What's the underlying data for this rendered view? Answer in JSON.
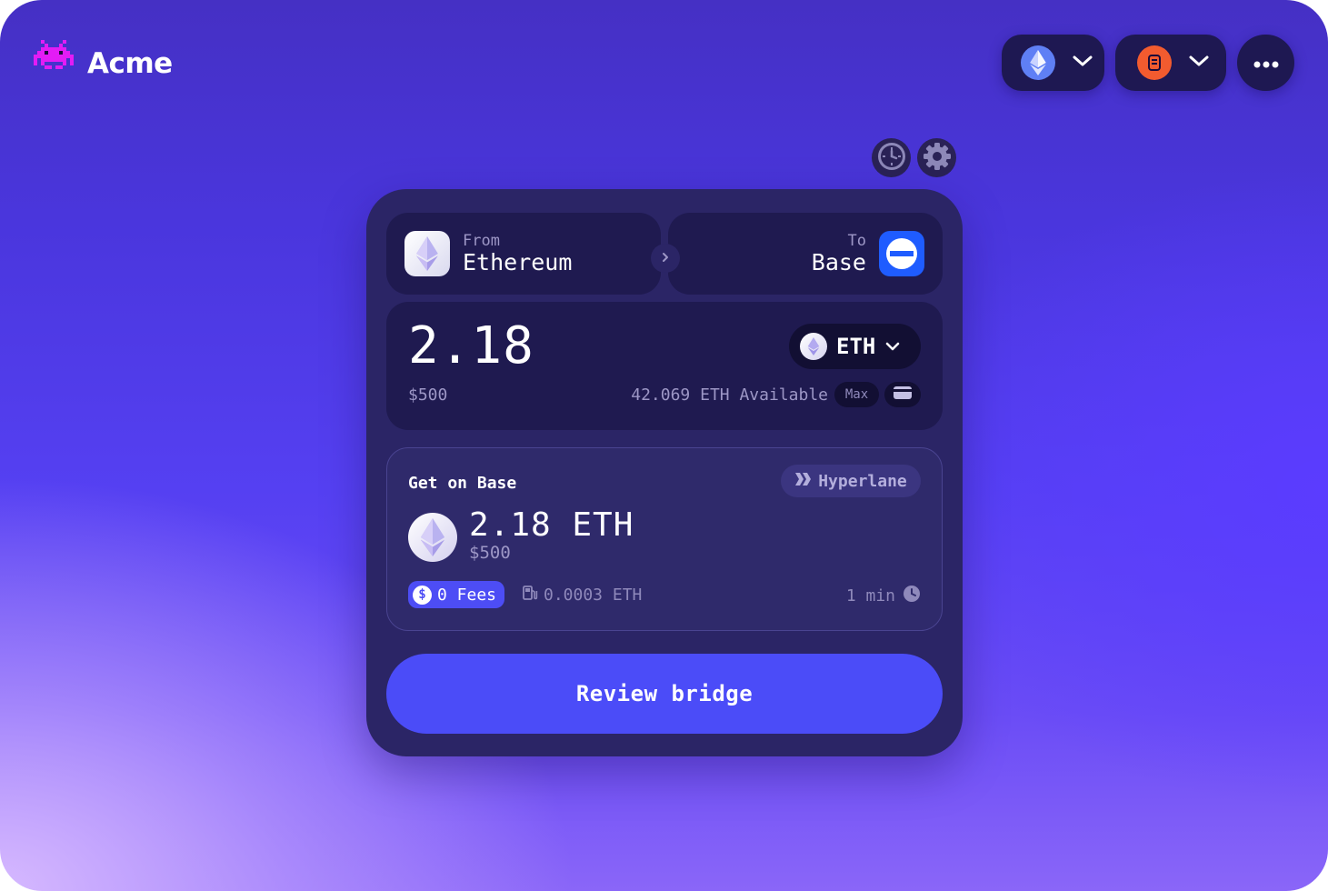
{
  "brand": {
    "name": "Acme"
  },
  "header": {
    "network_icon": "ethereum-icon",
    "account_icon": "account-avatar-icon",
    "more_icon": "more-dots-icon"
  },
  "tools": {
    "history_icon": "clock-icon",
    "settings_icon": "gear-icon"
  },
  "bridge": {
    "from": {
      "label": "From",
      "chain": "Ethereum"
    },
    "to": {
      "label": "To",
      "chain": "Base"
    },
    "amount": "2.18",
    "amount_usd": "$500",
    "token": "ETH",
    "available": "42.069 ETH Available",
    "max_label": "Max"
  },
  "receive": {
    "title": "Get on Base",
    "provider": "Hyperlane",
    "amount": "2.18 ETH",
    "amount_usd": "$500",
    "fees": "0 Fees",
    "gas": "0.0003 ETH",
    "eta": "1 min"
  },
  "actions": {
    "review_label": "Review bridge"
  },
  "colors": {
    "accent": "#4b4cf8",
    "card": "#2b2566",
    "panel": "#1f1a50",
    "brand_logo": "#e31cf5",
    "base": "#1f5cff"
  }
}
